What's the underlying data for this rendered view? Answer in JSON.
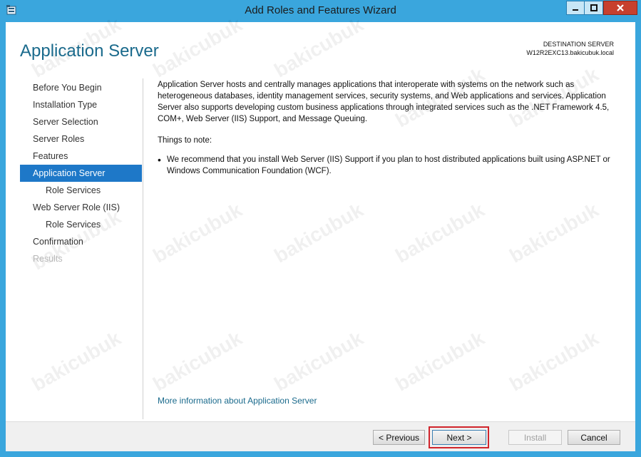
{
  "window": {
    "title": "Add Roles and Features Wizard",
    "icons": {
      "app": "server-manager-icon",
      "minimize": "minimize-icon",
      "maximize": "maximize-icon",
      "close": "close-icon"
    },
    "colors": {
      "frame": "#3aa6dd",
      "close_button": "#c7402e",
      "accent": "#1e78c8",
      "title_text": "#1a6a8c",
      "highlight_box": "#d0242b"
    }
  },
  "header": {
    "page_title": "Application Server",
    "destination_label": "DESTINATION SERVER",
    "destination_value": "W12R2EXC13.bakicubuk.local"
  },
  "nav": {
    "items": [
      {
        "label": "Before You Begin",
        "state": "normal"
      },
      {
        "label": "Installation Type",
        "state": "normal"
      },
      {
        "label": "Server Selection",
        "state": "normal"
      },
      {
        "label": "Server Roles",
        "state": "normal"
      },
      {
        "label": "Features",
        "state": "normal"
      },
      {
        "label": "Application Server",
        "state": "active"
      },
      {
        "label": "Role Services",
        "state": "sub"
      },
      {
        "label": "Web Server Role (IIS)",
        "state": "normal"
      },
      {
        "label": "Role Services",
        "state": "sub"
      },
      {
        "label": "Confirmation",
        "state": "normal"
      },
      {
        "label": "Results",
        "state": "disabled"
      }
    ]
  },
  "content": {
    "description": "Application Server hosts and centrally manages applications that interoperate with systems on the network such as heterogeneous databases, identity management services, security systems, and Web applications and services. Application Server also supports developing custom business applications through integrated services such as the .NET Framework 4.5, COM+, Web Server (IIS) Support, and Message Queuing.",
    "notes_heading": "Things to note:",
    "notes": [
      "We recommend that you install Web Server (IIS) Support if you plan to host distributed applications built using ASP.NET or Windows Communication Foundation (WCF)."
    ],
    "more_info_link": "More information about Application Server"
  },
  "footer": {
    "previous_label": "< Previous",
    "next_label": "Next >",
    "install_label": "Install",
    "cancel_label": "Cancel"
  },
  "watermark": {
    "text": "bakicubuk"
  }
}
